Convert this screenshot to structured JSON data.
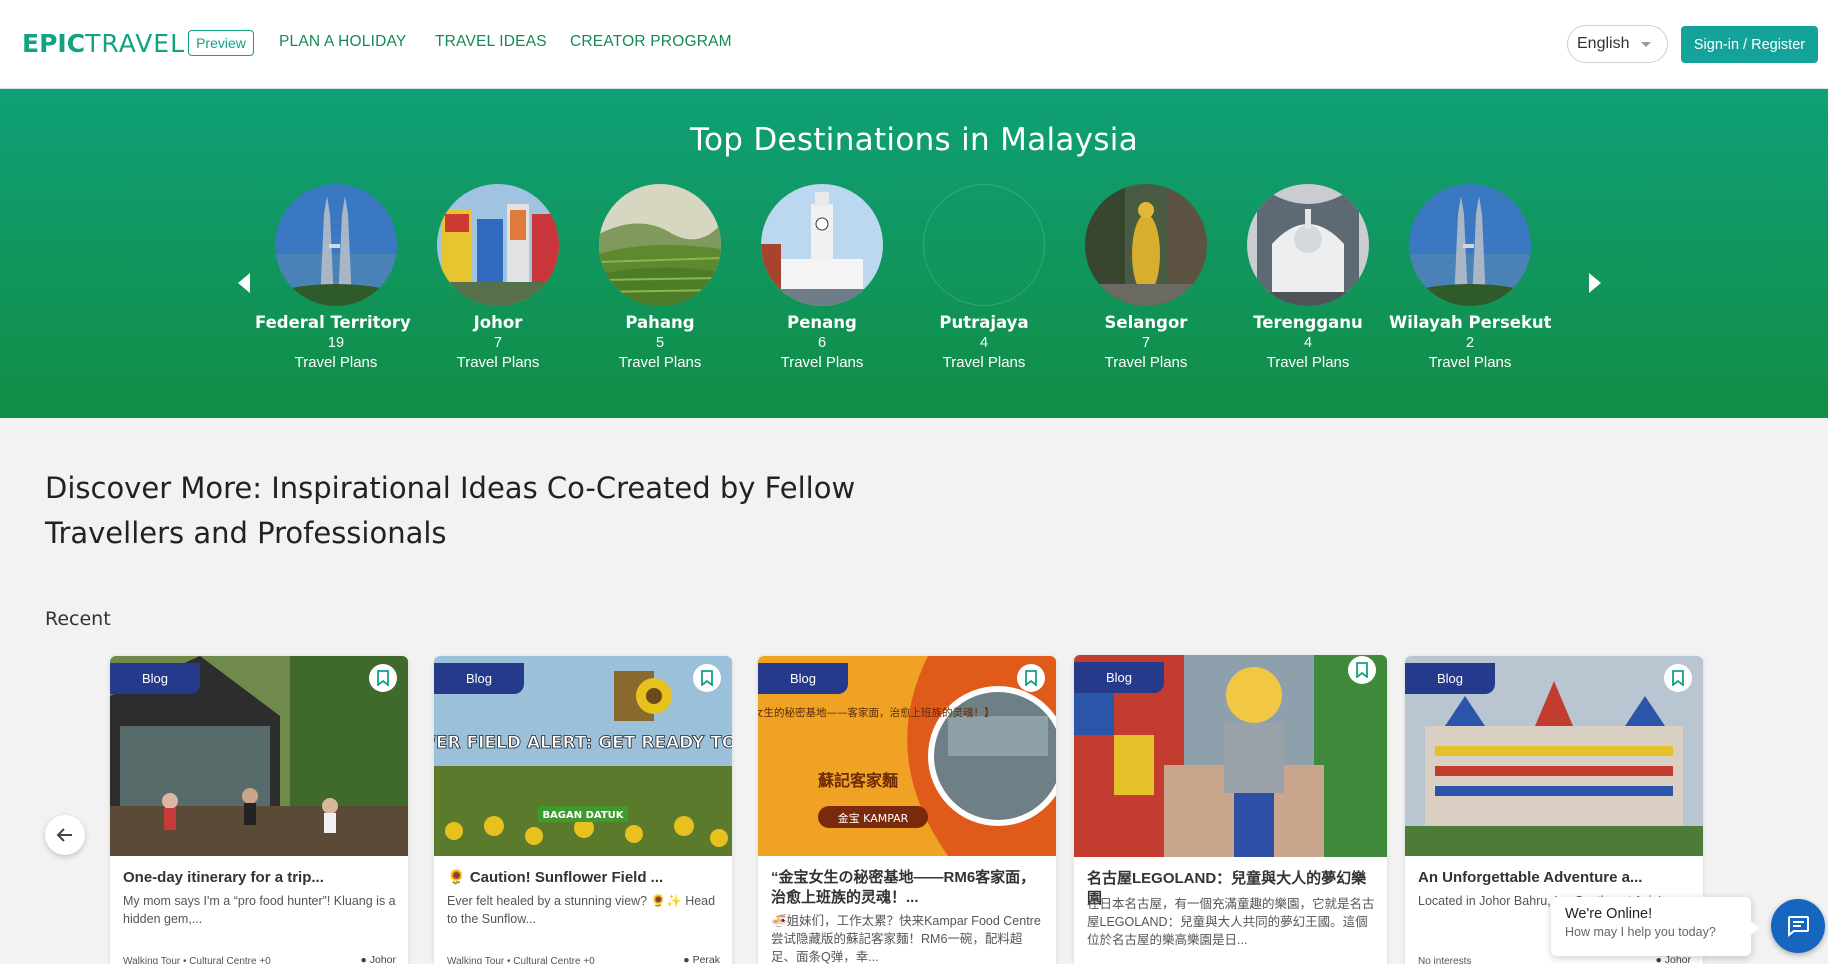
{
  "header": {
    "logo_epic": "EPIC",
    "logo_travel": "TRAVEL",
    "preview_badge": "Preview",
    "nav": [
      "PLAN A HOLIDAY",
      "TRAVEL IDEAS",
      "CREATOR PROGRAM"
    ],
    "language": "English",
    "signin_label": "Sign-in / Register"
  },
  "hero": {
    "title": "Top Destinations in Malaysia",
    "plans_label": "Travel Plans",
    "destinations": [
      {
        "name": "Federal Territory ...",
        "count": "19",
        "label": "Travel Plans"
      },
      {
        "name": "Johor",
        "count": "7",
        "label": "Travel Plans"
      },
      {
        "name": "Pahang",
        "count": "5",
        "label": "Travel Plans"
      },
      {
        "name": "Penang",
        "count": "6",
        "label": "Travel Plans"
      },
      {
        "name": "Putrajaya",
        "count": "4",
        "label": "Travel Plans"
      },
      {
        "name": "Selangor",
        "count": "7",
        "label": "Travel Plans"
      },
      {
        "name": "Terengganu",
        "count": "4",
        "label": "Travel Plans"
      },
      {
        "name": "Wilayah Persekutu",
        "count": "2",
        "label": "Travel Plans"
      }
    ]
  },
  "discover": {
    "title": "Discover More: Inspirational Ideas Co-Created by Fellow Travellers and Professionals",
    "recent_label": "Recent"
  },
  "cards": [
    {
      "tag": "Blog",
      "title": "One-day itinerary for a trip...",
      "desc": "My mom says I'm a “pro food hunter”! Kluang is a hidden gem,...",
      "meta": "Walking Tour  •  Cultural Centre +0",
      "location": "Johor"
    },
    {
      "tag": "Blog",
      "title": "🌻 Caution! Sunflower Field ...",
      "desc": "Ever felt healed by a stunning view? 🌻✨ Head to the Sunflow...",
      "meta": "Walking Tour  •  Cultural Centre +0",
      "location": "Perak",
      "img_text": "CAUTION! SUNFLOWER FIELD ALERT: GET READY TO BE AN INSTA STAR!",
      "img_sub": "BAGAN DATUK"
    },
    {
      "tag": "Blog",
      "title": "“金宝女生の秘密基地——RM6客家面，治愈上班族的灵魂！...",
      "desc": "🍜姐妹们，工作太累？快来Kampar Food Centre尝试隐藏版的蘇記客家麵！RM6一碗，配料超足、面条Q弹，幸...",
      "img_text": "【金宝女生的秘密基地——客家面，治愈上班族的灵魂！】",
      "img_sub": "蘇記客家麵",
      "img_loc": "金宝 KAMPAR"
    },
    {
      "tag": "Blog",
      "title": "名古屋LEGOLAND：兒童與大人的夢幻樂園",
      "desc": "在日本名古屋，有一個充滿童趣的樂園，它就是名古屋LEGOLAND：兒童與大人共同的夢幻王國。這個位於名古屋的樂高樂園是日..."
    },
    {
      "tag": "Blog",
      "title": "An Unforgettable Adventure a...",
      "desc": "Located in Johor Bahru, L... Southeast Asia'...",
      "meta": "No interests",
      "location": "Johor"
    }
  ],
  "chat": {
    "title": "We're Online!",
    "subtitle": "How may I help you today?"
  },
  "colors": {
    "brand_green": "#12a183",
    "hero_top": "#0fa077",
    "hero_bottom": "#118d45",
    "signin_bg": "#14a39b",
    "tag_bg": "#253a8a",
    "chat_btn": "#1666c0"
  },
  "icons": [
    "chevron-left-icon",
    "chevron-right-icon",
    "bookmark-icon",
    "arrow-left-icon",
    "map-pin-icon",
    "chat-icon",
    "caret-down-icon"
  ]
}
